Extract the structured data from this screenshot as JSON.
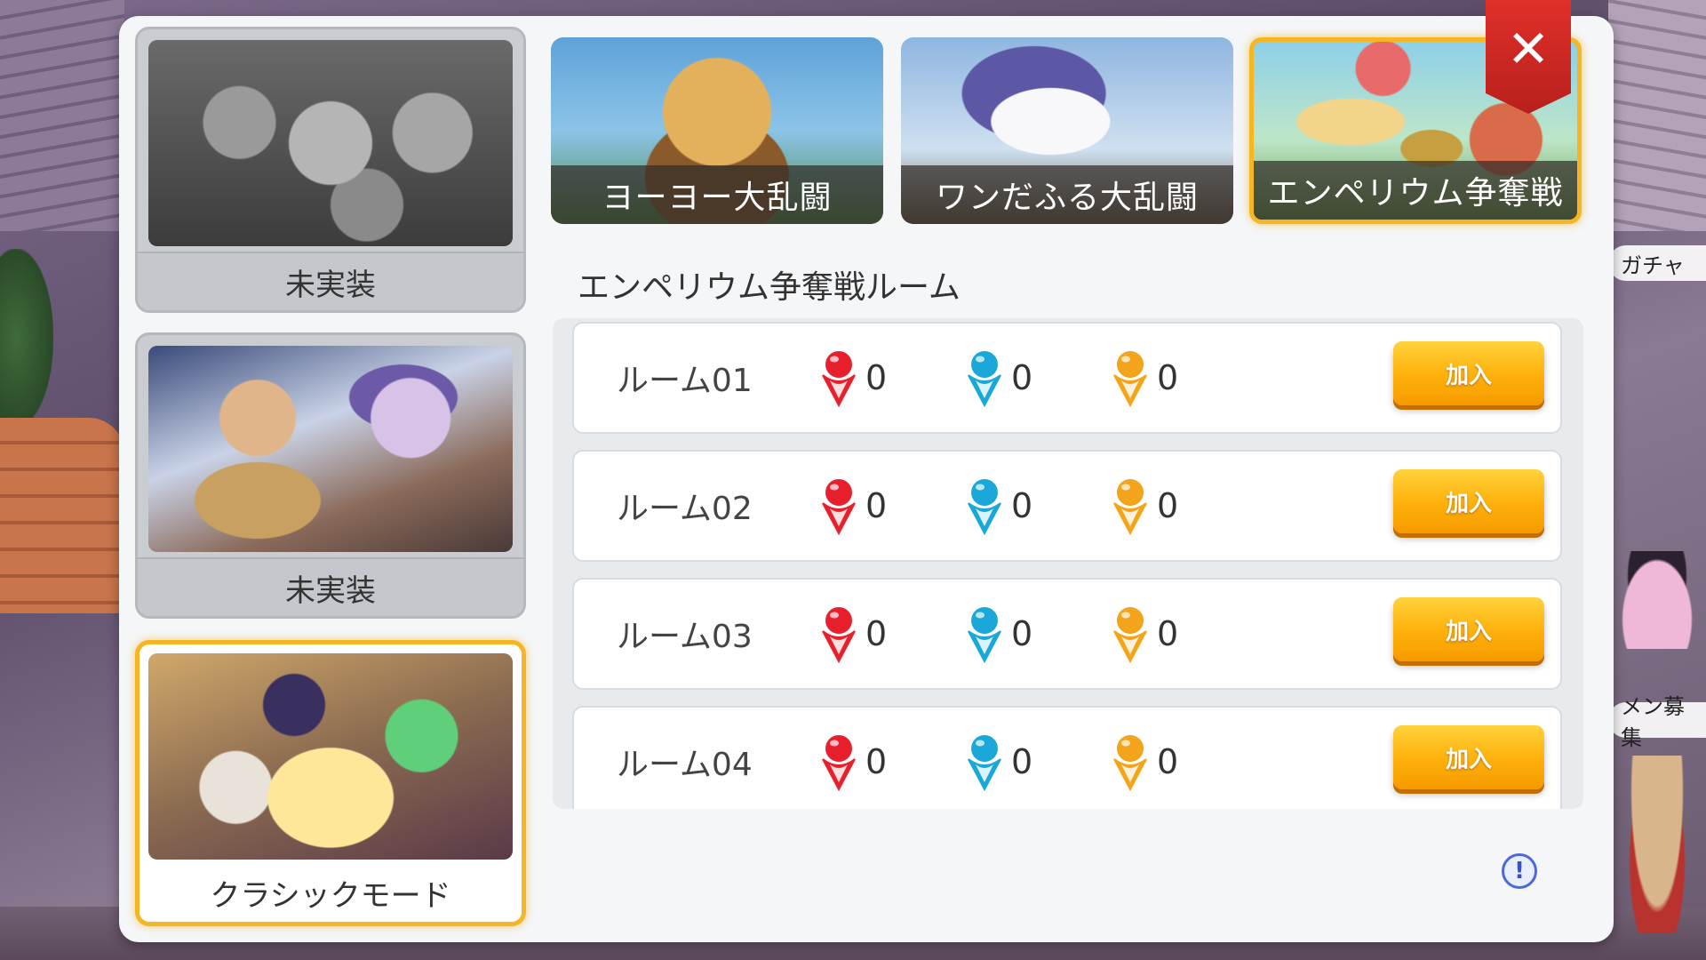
{
  "world": {
    "labels": {
      "gacha": "ガチャ",
      "recruit": "メン募集"
    }
  },
  "modes": [
    {
      "caption": "未実装",
      "art": "art-gray",
      "state": "disabled"
    },
    {
      "caption": "未実装",
      "art": "art-fight",
      "state": "disabled"
    },
    {
      "caption": "クラシックモード",
      "art": "art-classic",
      "state": "selected"
    }
  ],
  "events": [
    {
      "label": "ヨーヨー大乱闘",
      "art": "ev-yoyo",
      "selected": false
    },
    {
      "label": "ワンだふる大乱闘",
      "art": "ev-wan",
      "selected": false
    },
    {
      "label": "エンペリウム争奪戦",
      "art": "ev-emp",
      "selected": true
    }
  ],
  "close_icon": "close-icon",
  "room_section": {
    "title": "エンペリウム争奪戦ルーム",
    "join_label": "加入",
    "team_colors": {
      "red": "#e8202e",
      "blue": "#1aa8d8",
      "yellow": "#f2a41a"
    },
    "rooms": [
      {
        "name": "ルーム01",
        "red": "0",
        "blue": "0",
        "yellow": "0"
      },
      {
        "name": "ルーム02",
        "red": "0",
        "blue": "0",
        "yellow": "0"
      },
      {
        "name": "ルーム03",
        "red": "0",
        "blue": "0",
        "yellow": "0"
      },
      {
        "name": "ルーム04",
        "red": "0",
        "blue": "0",
        "yellow": "0"
      }
    ]
  },
  "info_icon": "info-icon",
  "info_symbol": "!"
}
